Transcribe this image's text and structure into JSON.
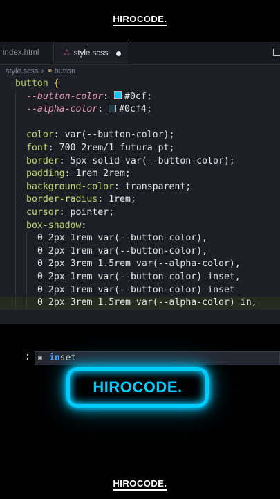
{
  "brand": {
    "top": "HIROCODE.",
    "bottom": "HIROCODE."
  },
  "tabs": [
    {
      "label": "index.html",
      "active": false
    },
    {
      "label": "style.scss",
      "active": true,
      "modified": true
    }
  ],
  "breadcrumb": {
    "file": "style.scss",
    "symbol": "button"
  },
  "code": {
    "selector": "button",
    "open_brace": "{",
    "var1_name": "--button-color",
    "var1_value": "#0cf",
    "var2_name": "--alpha-color",
    "var2_value": "#0cf4",
    "lines": [
      {
        "prop": "color",
        "value": "var(--button-color);"
      },
      {
        "prop": "font",
        "value": "700 2rem/1 futura pt;"
      },
      {
        "prop": "border",
        "value": "5px solid var(--button-color);"
      },
      {
        "prop": "padding",
        "value": "1rem 2rem;"
      },
      {
        "prop": "background-color",
        "value": "transparent;"
      },
      {
        "prop": "border-radius",
        "value": "1rem;"
      },
      {
        "prop": "cursor",
        "value": "pointer;"
      },
      {
        "prop": "box-shadow",
        "value": ""
      }
    ],
    "shadows": [
      "0 2px 1rem var(--button-color),",
      "0 2px 1rem var(--button-color),",
      "0 2px 3rem 1.5rem var(--alpha-color),",
      "0 2px 1rem var(--button-color) inset,",
      "0 2px 1rem var(--button-color) inset",
      "0 2px 3rem 1.5rem var(--alpha-color) in,"
    ]
  },
  "suggestion": {
    "match": "in",
    "rest": "set",
    "semicolon": ";"
  },
  "demo_button": {
    "label": "HIROCODE.",
    "color": "#00ccff"
  }
}
